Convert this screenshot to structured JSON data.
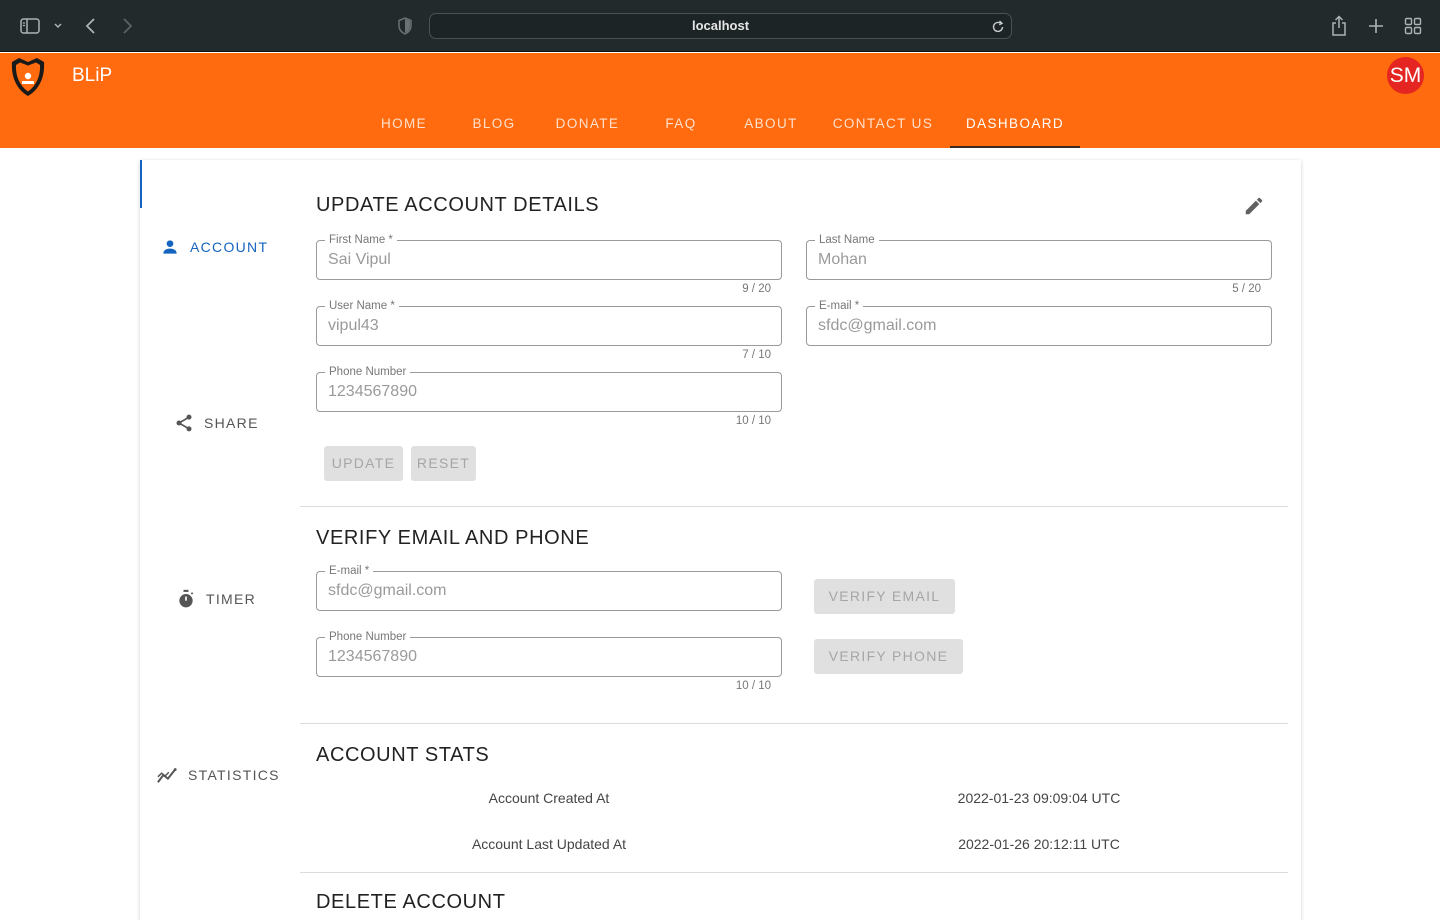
{
  "browser": {
    "url": "localhost"
  },
  "app": {
    "brand": "BLiP",
    "avatar_initials": "SM",
    "accent_color": "#ff6b0e",
    "nav": [
      "HOME",
      "BLOG",
      "DONATE",
      "FAQ",
      "ABOUT",
      "CONTACT US",
      "DASHBOARD"
    ],
    "active_nav": "DASHBOARD"
  },
  "sidebar": {
    "items": [
      {
        "label": "ACCOUNT",
        "icon": "person-icon",
        "active": true
      },
      {
        "label": "SHARE",
        "icon": "share-icon",
        "active": false
      },
      {
        "label": "TIMER",
        "icon": "timer-icon",
        "active": false
      },
      {
        "label": "STATISTICS",
        "icon": "statistics-icon",
        "active": false
      }
    ]
  },
  "update_account": {
    "title": "UPDATE ACCOUNT DETAILS",
    "first_name": {
      "label": "First Name *",
      "value": "Sai Vipul",
      "counter": "9 / 20"
    },
    "last_name": {
      "label": "Last Name",
      "value": "Mohan",
      "counter": "5 / 20"
    },
    "user_name": {
      "label": "User Name *",
      "value": "vipul43",
      "counter": "7 / 10"
    },
    "email": {
      "label": "E-mail *",
      "value": "sfdc@gmail.com"
    },
    "phone": {
      "label": "Phone Number",
      "value": "1234567890",
      "counter": "10 / 10"
    },
    "update_label": "UPDATE",
    "reset_label": "RESET"
  },
  "verify": {
    "title": "VERIFY EMAIL AND PHONE",
    "email": {
      "label": "E-mail *",
      "value": "sfdc@gmail.com"
    },
    "phone": {
      "label": "Phone Number",
      "value": "1234567890",
      "counter": "10 / 10"
    },
    "verify_email_label": "VERIFY EMAIL",
    "verify_phone_label": "VERIFY PHONE"
  },
  "stats": {
    "title": "ACCOUNT STATS",
    "created_label": "Account Created At",
    "created_value": "2022-01-23 09:09:04 UTC",
    "updated_label": "Account Last Updated At",
    "updated_value": "2022-01-26 20:12:11 UTC"
  },
  "delete": {
    "title": "DELETE ACCOUNT"
  }
}
